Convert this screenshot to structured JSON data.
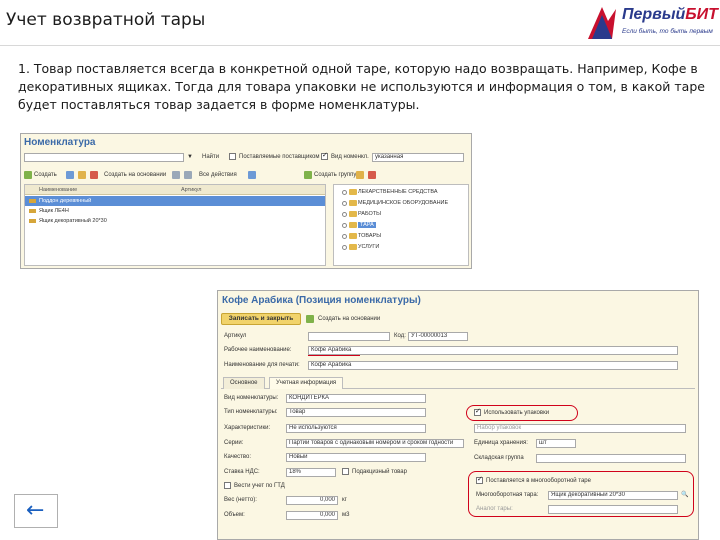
{
  "slide": {
    "title": "Учет возвратной тары",
    "paragraph": "1.   Товар поставляется всегда в конкретной одной таре, которую надо возвращать. Например, Кофе в декоративных ящиках. Тогда для товара упаковки не используются и информация о том, в какой таре будет поставляться товар задается в форме номенклатуры."
  },
  "logo": {
    "brand_part1": "Первый",
    "brand_part2": "БИТ",
    "slogan": "Если быть, то быть первым"
  },
  "win1": {
    "title": "Номенклатура",
    "find_label": "Найти",
    "only_owned_label": "Поставляемые поставщиком",
    "type_label": "Вид номенкл.",
    "type_value": "указанная",
    "create_label": "Создать",
    "create_based_label": "Создать на основании",
    "all_actions_label": "Все действия",
    "create_group_label": "Создать группу",
    "col_name": "Наименование",
    "col_article": "Артикул",
    "rows": [
      "Поддон деревянный",
      "Ящик ЛЕ4Н",
      "Ящик декоративный 20*30"
    ],
    "tree": [
      "ЛЕКАРСТВЕННЫЕ СРЕДСТВА",
      "МЕДИЦИНСКОЕ ОБОРУДОВАНИЕ",
      "РАБОТЫ",
      "ТАРА",
      "ТОВАРЫ",
      "УСЛУГИ"
    ]
  },
  "win2": {
    "title": "Кофе Арабика (Позиция номенклатуры)",
    "save_close": "Записать и закрыть",
    "create_based": "Создать на основании",
    "article_label": "Артикул",
    "code_label": "Код:",
    "code_value": "УТ-00000013",
    "work_name_label": "Рабочее наименование:",
    "work_name_value": "Кофе Арабика",
    "full_name_label": "Наименование для печати:",
    "full_name_value": "Кофе Арабика",
    "tab_main": "Основное",
    "tab_accounting": "Учетная информация",
    "kind_label": "Вид номенклатуры:",
    "kind_value": "КОНДИТЕРКА",
    "type_label": "Тип номенклатуры:",
    "type_value": "Товар",
    "use_packages": "Использовать упаковки",
    "package_set": "Набор упаковок",
    "characteristics_label": "Характеристики:",
    "characteristics_value": "Не используются",
    "series_label": "Серии:",
    "series_value": "Партии товаров с одинаковым номером и сроком годности",
    "unit_label": "Единица хранения:",
    "unit_value": "шт",
    "quality_label": "Качество:",
    "quality_value": "Новый",
    "warehouse_group_label": "Складская группа",
    "vat_label": "Ставка НДС:",
    "vat_value": "18%",
    "excise_label": "Подакцизный товар",
    "reusable_label": "Поставляется в многооборотной таре",
    "container_label": "Многооборотная тара:",
    "container_value": "Ящик декоративный 20*30",
    "gtd_label": "Вести учет по ГТД",
    "tare_label": "Аналог тары:",
    "weight_label": "Вес (нетто):",
    "weight_value": "0,000",
    "weight_unit": "кг",
    "volume_label": "Объем:",
    "volume_value": "0,000",
    "volume_unit": "м3"
  },
  "nav": {
    "back_glyph": "←"
  },
  "colors": {
    "accent_red": "#d0021b",
    "window_bg": "#fbf7e3",
    "title_blue": "#3b6aa8",
    "selection_blue": "#5b8ed6"
  }
}
